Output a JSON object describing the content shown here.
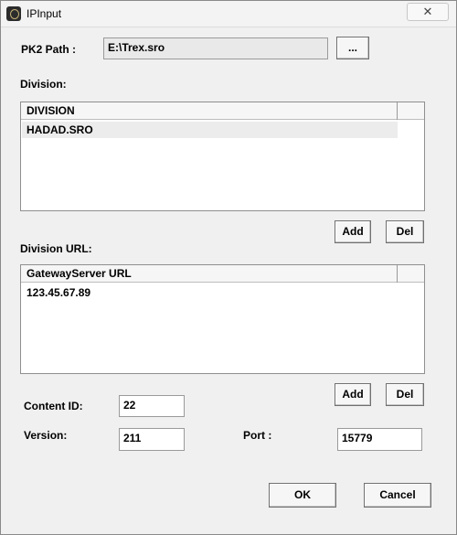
{
  "window": {
    "title": "IPInput",
    "close_glyph": "✕"
  },
  "pk2": {
    "label": "PK2 Path :",
    "value": "E:\\Trex.sro",
    "browse_label": "..."
  },
  "division": {
    "section_label": "Division:",
    "column_header": "DIVISION",
    "rows": [
      "HADAD.SRO"
    ],
    "add_label": "Add",
    "del_label": "Del"
  },
  "division_url": {
    "section_label": "Division URL:",
    "column_header": "GatewayServer URL",
    "rows": [
      "123.45.67.89"
    ],
    "add_label": "Add",
    "del_label": "Del"
  },
  "fields": {
    "content_id_label": "Content ID:",
    "content_id_value": "22",
    "version_label": "Version:",
    "version_value": "211",
    "port_label": "Port :",
    "port_value": "15779"
  },
  "footer": {
    "ok_label": "OK",
    "cancel_label": "Cancel"
  },
  "icons": {
    "app": "app-icon",
    "close": "close-icon"
  }
}
